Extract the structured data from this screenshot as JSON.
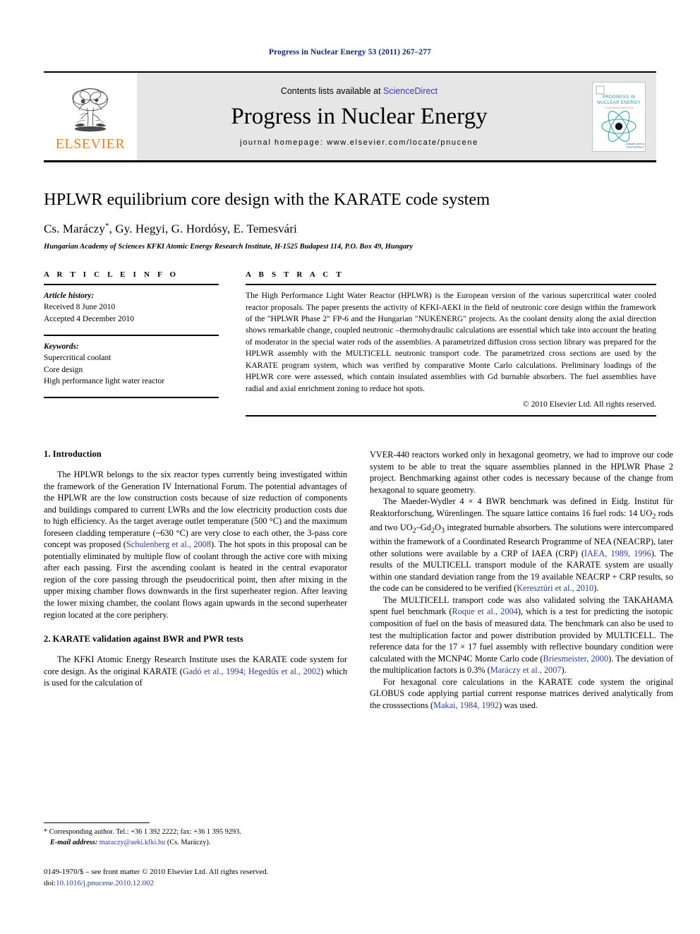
{
  "running_head": "Progress in Nuclear Energy 53 (2011) 267–277",
  "masthead": {
    "publisher_name": "ELSEVIER",
    "contents_prefix": "Contents lists available at ",
    "sciencedirect_link": "ScienceDirect",
    "journal_name": "Progress in Nuclear Energy",
    "homepage_label": "journal homepage: www.elsevier.com/locate/pnucene",
    "cover": {
      "line1": "PROGRESS IN",
      "line2": "NUCLEAR ENERGY",
      "line3": "An international review journal",
      "footer": "ScienceDirect"
    },
    "link_color": "#3a3ab0",
    "band_color": "#e6e6e6",
    "elsevier_orange": "#f07f1a"
  },
  "article": {
    "title": "HPLWR equilibrium core design with the KARATE code system",
    "authors": "Cs. Maráczy",
    "authors_rest": ", Gy. Hegyi, G. Hordósy, E. Temesvári",
    "author_marker": "*",
    "affiliation": "Hungarian Academy of Sciences KFKI Atomic Energy Research Institute, H-1525 Budapest 114, P.O. Box 49, Hungary"
  },
  "article_info": {
    "heading": "A R T I C L E   I N F O",
    "history_label": "Article history:",
    "history": [
      "Received 8 June 2010",
      "Accepted 4 December 2010"
    ],
    "keywords_label": "Keywords:",
    "keywords": [
      "Supercritical coolant",
      "Core design",
      "High performance light water reactor"
    ]
  },
  "abstract": {
    "heading": "A B S T R A C T",
    "text": "The High Performance Light Water Reactor (HPLWR) is the European version of the various supercritical water cooled reactor proposals. The paper presents the activity of KFKI-AEKI in the field of neutronic core design within the framework of the \"HPLWR Phase 2\" FP-6 and the Hungarian \"NUKENERG\" projects. As the coolant density along the axial direction shows remarkable change, coupled neutronic –thermohydraulic calculations are essential which take into account the heating of moderator in the special water rods of the assemblies. A parametrized diffusion cross section library was prepared for the HPLWR assembly with the MULTICELL neutronic transport code. The parametrized cross sections are used by the KARATE program system, which was verified by comparative Monte Carlo calculations. Preliminary loadings of the HPLWR core were assessed, which contain insulated assemblies with Gd burnable absorbers. The fuel assemblies have radial and axial enrichment zoning to reduce hot spots.",
    "copyright": "© 2010 Elsevier Ltd. All rights reserved."
  },
  "sections": {
    "intro_heading": "1. Introduction",
    "karate_heading": "2. KARATE validation against BWR and PWR tests"
  },
  "body": {
    "left": {
      "p1_a": "The HPLWR belongs to the six reactor types currently being investigated within the framework of the Generation IV International Forum. The potential advantages of the HPLWR are the low construction costs because of size reduction of components and buildings compared to current LWRs and the low electricity production costs due to high efficiency. As the target average outlet temperature (500 °C) and the maximum foreseen cladding temperature (~630 °C) are very close to each other, the 3-pass core concept was proposed (",
      "p1_ref1": "Schulenberg et al., 2008",
      "p1_b": "). The hot spots in this proposal can be potentially eliminated by multiple flow of coolant through the active core with mixing after each passing. First the ascending coolant is heated in the central evaporator region of the core passing through the pseudocritical point, then after mixing in the upper mixing chamber flows downwards in the first superheater region. After leaving the lower mixing chamber, the coolant flows again upwards in the second superheater region located at the core periphery.",
      "p2_a": "The KFKI Atomic Energy Research Institute uses the KARATE code system for core design. As the original KARATE (",
      "p2_ref1": "Gadó et al., 1994; Hegedűs et al., 2002",
      "p2_b": ") which is used for the calculation of"
    },
    "right": {
      "p1": "VVER-440 reactors worked only in hexagonal geometry, we had to improve our code system to be able to treat the square assemblies planned in the HPLWR Phase 2 project. Benchmarking against other codes is necessary because of the change from hexagonal to square geometry.",
      "p2_a": "The Maeder-Wydler 4 × 4 BWR benchmark was defined in Eidg. Institut für Reaktorforschung, Würenlingen. The square lattice contains 16 fuel rods: 14 UO",
      "p2_sub1": "2",
      "p2_b": " rods and two UO",
      "p2_sub2": "2",
      "p2_c": "–Gd",
      "p2_sub3": "2",
      "p2_d": "O",
      "p2_sub4": "3",
      "p2_e": " integrated burnable absorbers. The solutions were intercompared within the framework of a Coordinated Research Programme of NEA (NEACRP), later other solutions were available by a CRP of IAEA (CRP) (",
      "p2_ref1": "IAEA, 1989, 1996",
      "p2_f": "). The results of the MULTICELL transport module of the KARATE system are usually within one standard deviation range from the 19 available NEACRP + CRP results, so the code can be considered to be verified (",
      "p2_ref2": "Keresztúri et al., 2010",
      "p2_g": ").",
      "p3_a": "The MULTICELL transport code was also validated solving the TAKAHAMA spent fuel benchmark (",
      "p3_ref1": "Roque et al., 2004",
      "p3_b": "), which is a test for predicting the isotopic composition of fuel on the basis of measured data. The benchmark can also be used to test the multiplication factor and power distribution provided by MULTICELL. The reference data for the 17 × 17 fuel assembly with reflective boundary condition were calculated with the MCNP4C Monte Carlo code (",
      "p3_ref2": "Briesmeister, 2000",
      "p3_c": "). The deviation of the multiplication factors is 0.3% (",
      "p3_ref3": "Maráczy et al., 2007",
      "p3_d": ").",
      "p4_a": "For hexagonal core calculations in the KARATE code system the original GLOBUS code applying partial current response matrices derived analytically from the crosssections (",
      "p4_ref1": "Makai, 1984, 1992",
      "p4_b": ") was used."
    }
  },
  "footnote": {
    "marker": "*",
    "corresponding": " Corresponding author. Tel.: +36 1 392 2222; fax: +36 1 395 9293.",
    "email_label": "E-mail address:",
    "email": "maraczy@aeki.kfki.hu",
    "email_suffix": " (Cs. Maráczy)."
  },
  "footer": {
    "issn_line": "0149-1970/$ – see front matter © 2010 Elsevier Ltd. All rights reserved.",
    "doi_label": "doi:",
    "doi_value": "10.1016/j.pnucene.2010.12.002"
  }
}
